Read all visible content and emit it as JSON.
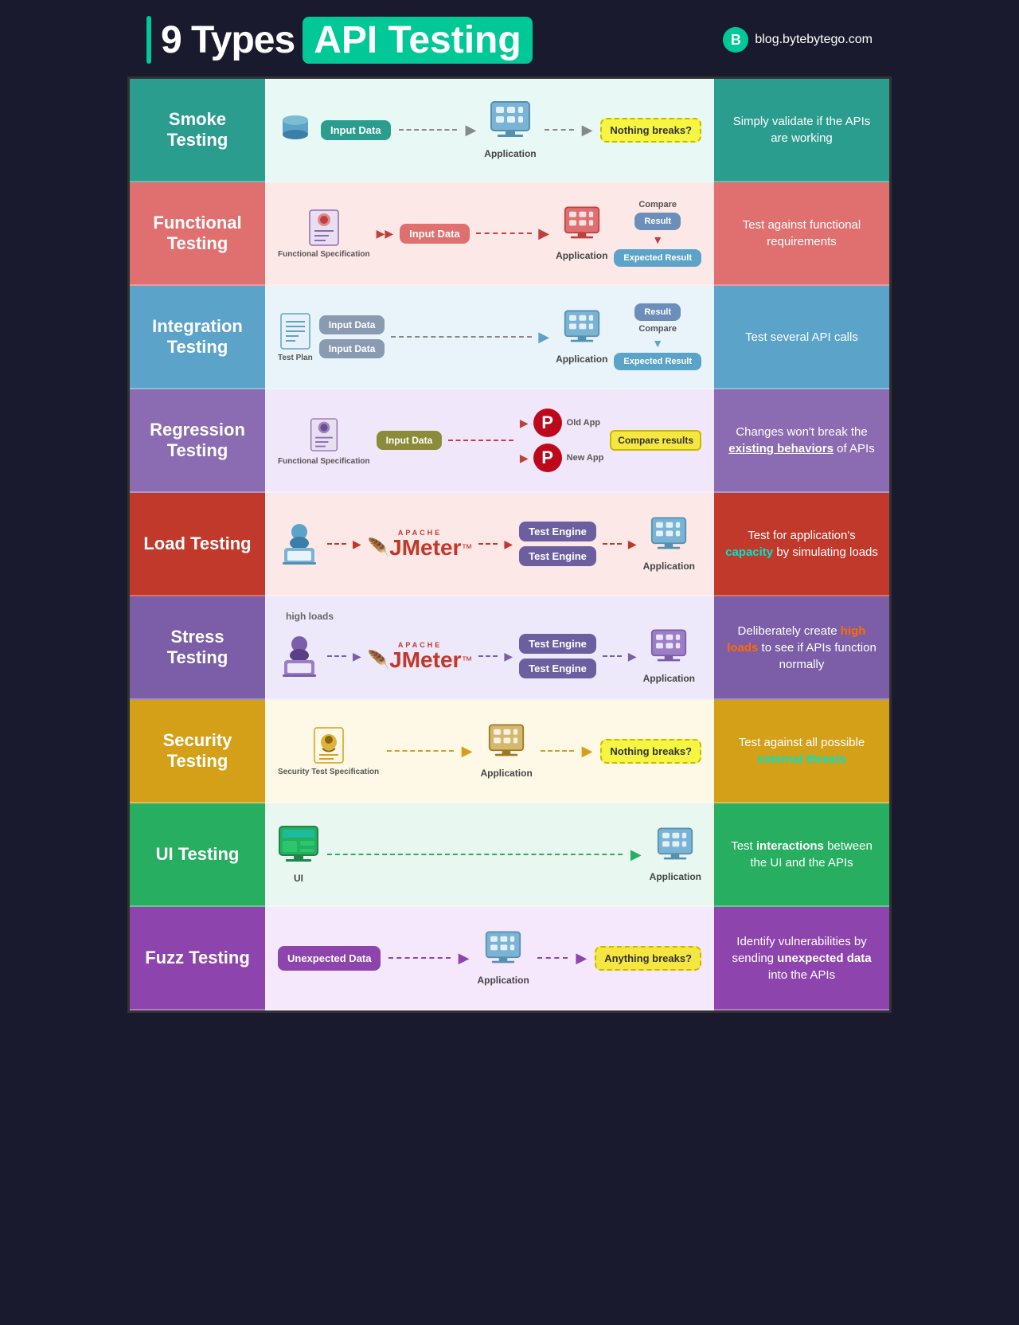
{
  "header": {
    "title_prefix": "9 Types ",
    "title_highlight": "API Testing",
    "brand": "blog.bytebytego.com"
  },
  "rows": [
    {
      "id": "smoke",
      "label": "Smoke Testing",
      "desc": "Simply validate if the APIs are working",
      "desc_highlights": []
    },
    {
      "id": "functional",
      "label": "Functional Testing",
      "desc": "Test against functional requirements",
      "desc_highlights": []
    },
    {
      "id": "integration",
      "label": "Integration Testing",
      "desc": "Test several API calls",
      "desc_highlights": []
    },
    {
      "id": "regression",
      "label": "Regression Testing",
      "desc": "Changes won't break the existing behaviors of APIs",
      "desc_highlights": [
        "existing behaviors"
      ]
    },
    {
      "id": "load",
      "label": "Load Testing",
      "desc": "Test for application's capacity by simulating loads",
      "desc_highlights": [
        "capacity"
      ]
    },
    {
      "id": "stress",
      "label": "Stress Testing",
      "desc": "Deliberately create high loads to see if APIs function normally",
      "desc_highlights": [
        "high loads"
      ]
    },
    {
      "id": "security",
      "label": "Security Testing",
      "desc": "Test against all possible external threats",
      "desc_highlights": [
        "external threats"
      ]
    },
    {
      "id": "ui",
      "label": "UI Testing",
      "desc": "Test interactions between the UI and the APIs",
      "desc_highlights": [
        "interactions"
      ]
    },
    {
      "id": "fuzz",
      "label": "Fuzz Testing",
      "desc": "Identify vulnerabilities by sending unexpected data into the APIs",
      "desc_highlights": [
        "unexpected data"
      ]
    }
  ],
  "labels": {
    "input_data": "Input Data",
    "application": "Application",
    "nothing_breaks": "Nothing breaks?",
    "anything_breaks": "Anything breaks?",
    "result": "Result",
    "expected_result": "Expected Result",
    "compare": "Compare",
    "functional_spec": "Functional Specification",
    "test_plan": "Test Plan",
    "old_app": "Old App",
    "new_app": "New App",
    "compare_results": "Compare results",
    "test_engine": "Test Engine",
    "high_loads": "high loads",
    "security_test_spec": "Security Test Specification",
    "ui_label": "UI",
    "unexpected_data": "Unexpected Data",
    "jmeter_apache": "APACHE",
    "jmeter_main": "JMeter"
  }
}
